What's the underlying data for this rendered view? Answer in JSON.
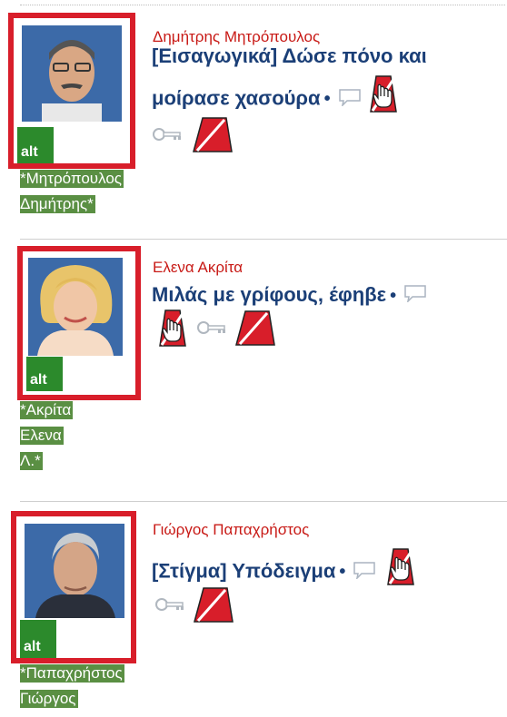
{
  "articles": [
    {
      "author": "Δημήτρης Μητρόπουλος",
      "title": "[Εισαγωγικά] Δώσε πόνο και μοίρασε χασούρα",
      "bullet": "•",
      "alt_label": "alt",
      "tag_lines": [
        "*Μητρόπουλος",
        "Δημήτρης*"
      ]
    },
    {
      "author": "Ελενα Ακρίτα",
      "title": "Μιλάς με γρίφους, έφηβε",
      "bullet": "•",
      "alt_label": "alt",
      "tag_lines": [
        "*Ακρίτα",
        "Ελενα",
        "Λ.*"
      ]
    },
    {
      "author": "Γιώργος Παπαχρήστος",
      "title": "[Στίγμα] Υπόδειγμα",
      "bullet": "•",
      "alt_label": "alt",
      "tag_lines": [
        "*Παπαχρήστος",
        "Γιώργος"
      ]
    }
  ],
  "icons": {
    "comment": "comment-bubble-icon",
    "no_touch": "no-touch-hand-icon",
    "key": "key-icon",
    "prohibited": "prohibited-slash-icon"
  },
  "colors": {
    "frame_red": "#d81e2a",
    "author_red": "#c81a16",
    "title_blue": "#1b3f77",
    "alt_green": "#2c8a2c",
    "tag_green": "#5a8f43"
  }
}
